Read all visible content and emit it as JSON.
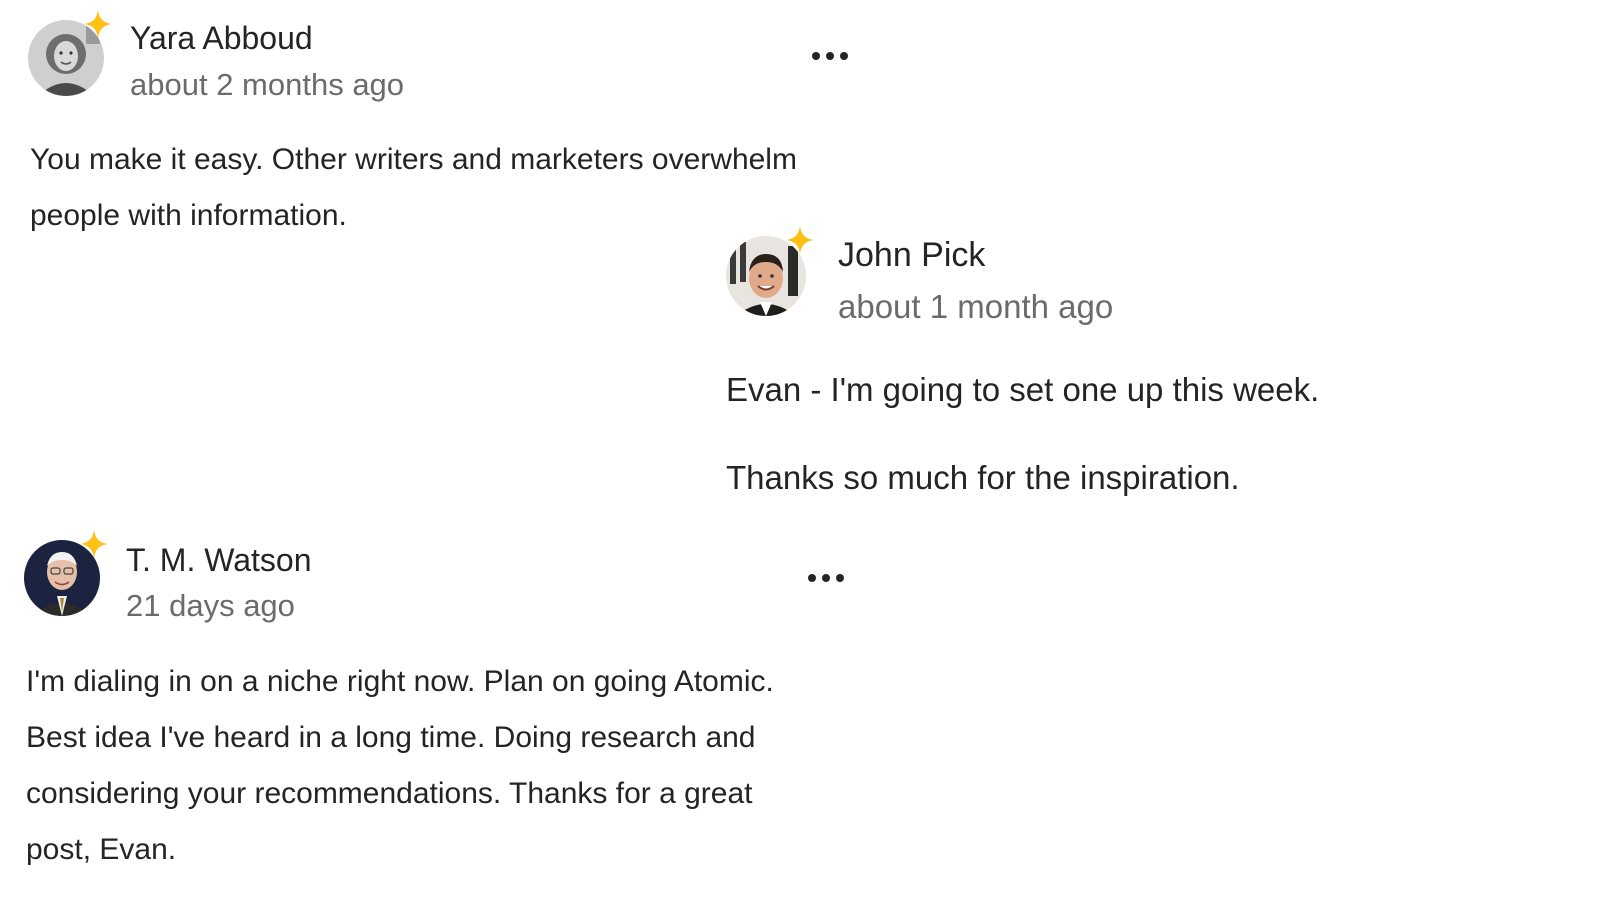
{
  "comments": [
    {
      "author": "Yara Abboud",
      "time": "about 2 months ago",
      "text": "You make it easy. Other writers and marketers overwhelm\npeople with information.",
      "more_icon": "more-horizontal-icon",
      "badge_icon": "sparkle-star-icon"
    },
    {
      "author": "T. M. Watson",
      "time": "21 days ago",
      "text": "I'm dialing in on a niche right now. Plan on going Atomic.\nBest idea I've heard in a long time. Doing research and\nconsidering your recommendations. Thanks for a great\npost, Evan.",
      "more_icon": "more-horizontal-icon",
      "badge_icon": "sparkle-star-icon"
    }
  ],
  "reply": {
    "author": "John Pick",
    "time": "about 1 month ago",
    "paragraphs": [
      "Evan - I'm going to set one up this week.",
      "Thanks so much for the inspiration."
    ],
    "badge_icon": "sparkle-star-icon"
  },
  "colors": {
    "text": "#242424",
    "muted": "#6b6b6b",
    "badge": "#FFC017"
  }
}
